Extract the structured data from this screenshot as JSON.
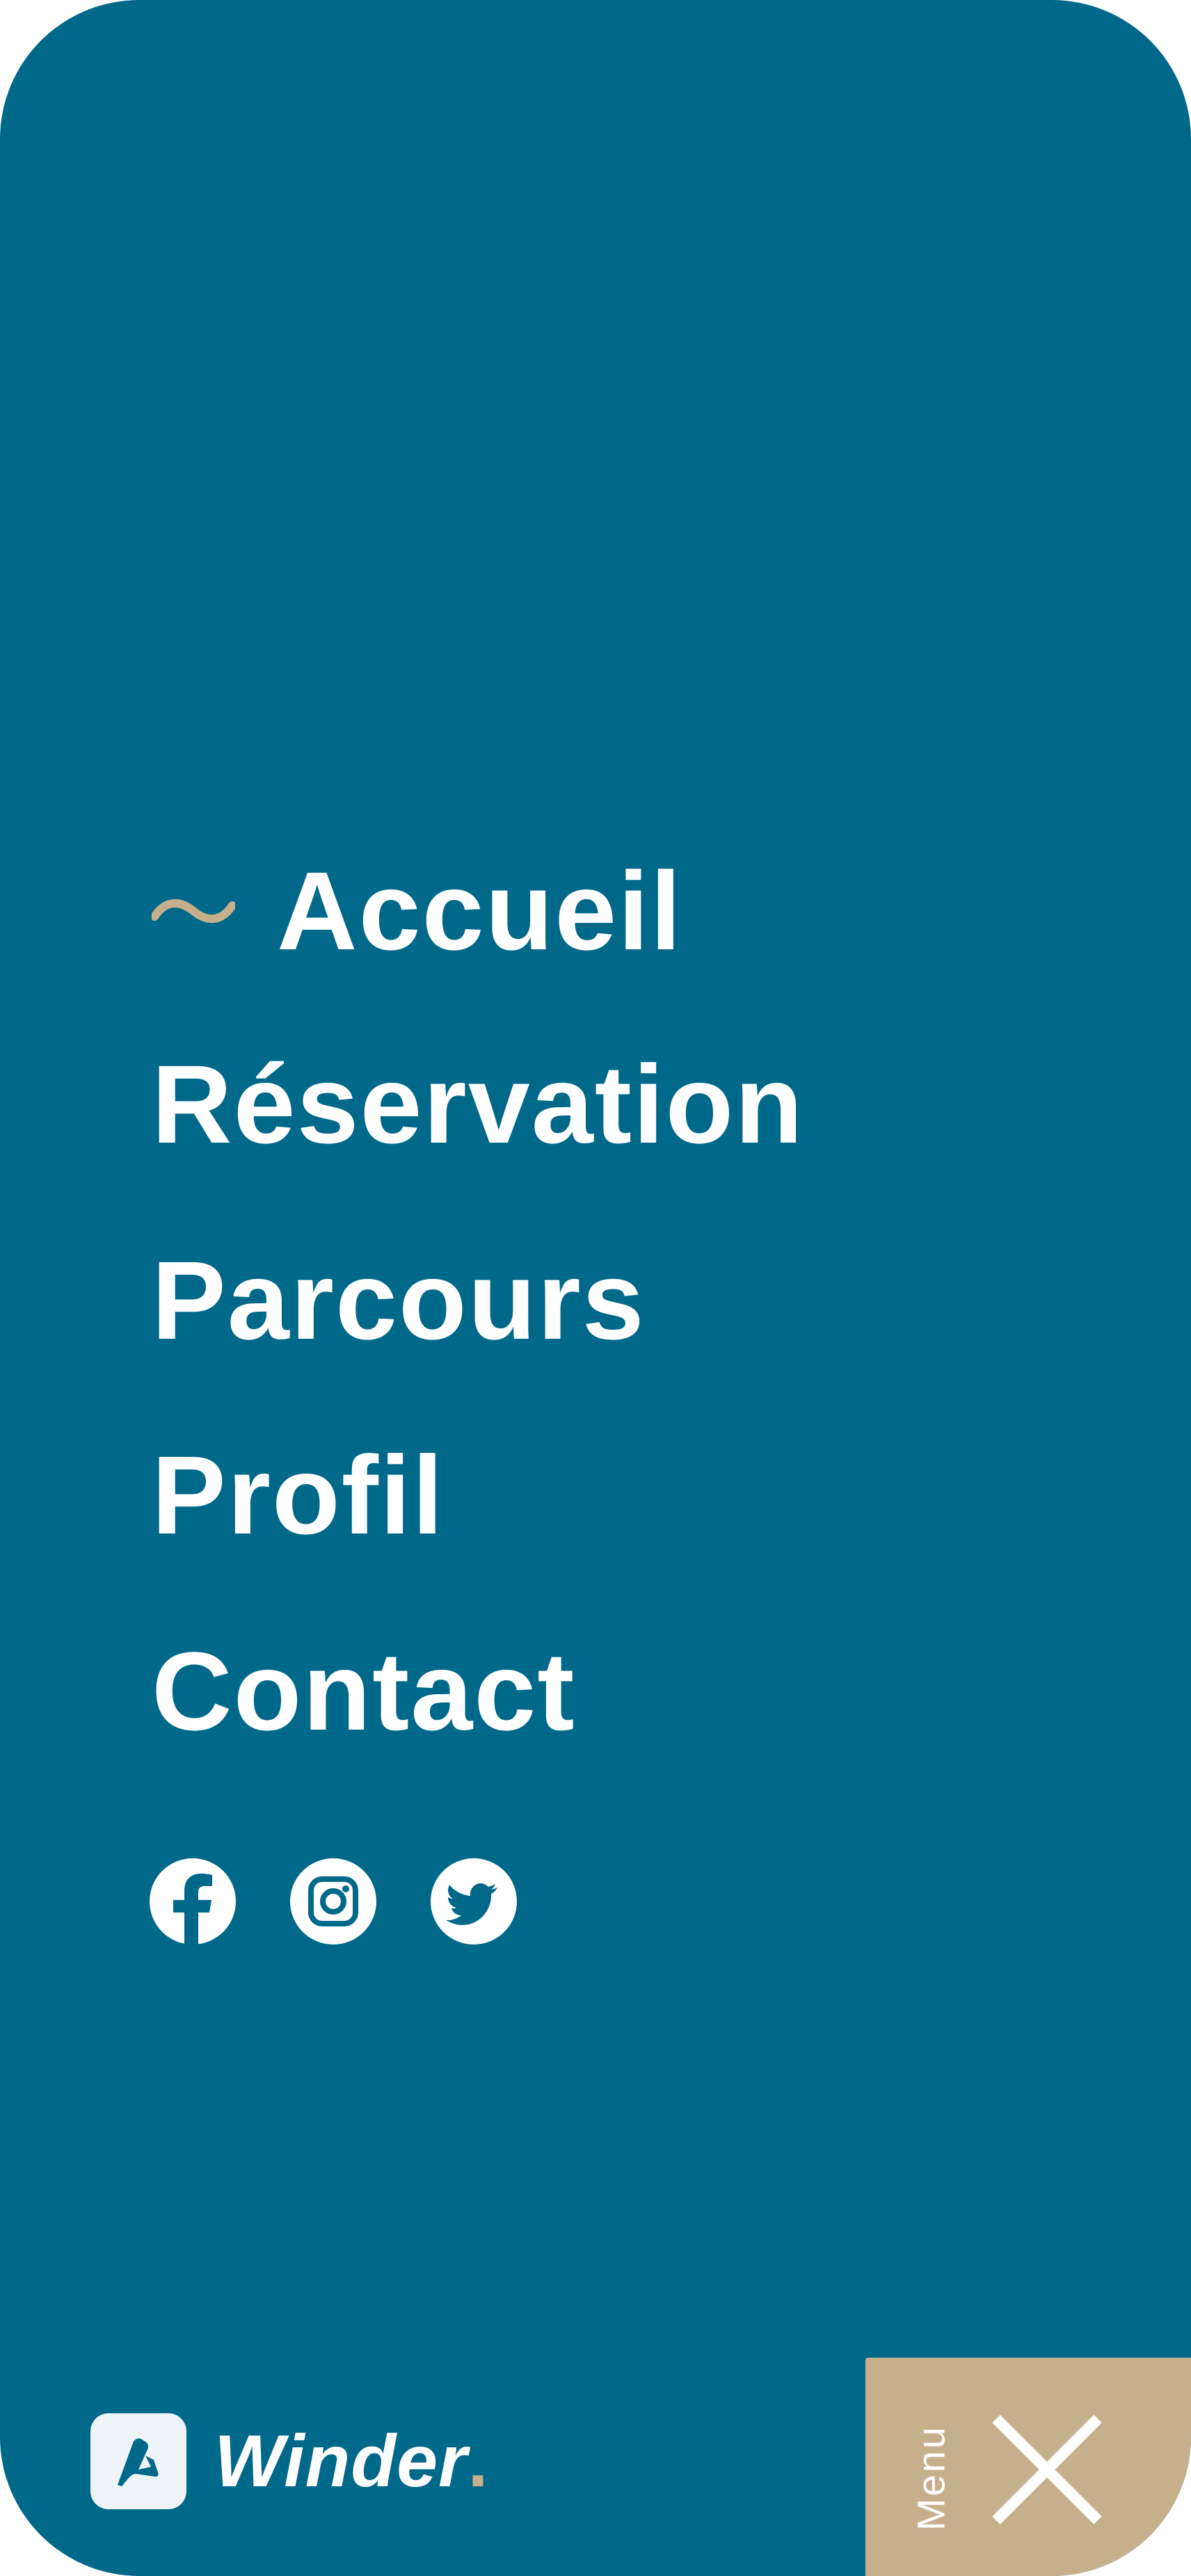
{
  "nav": {
    "items": [
      {
        "label": "Accueil",
        "active": true
      },
      {
        "label": "Réservation"
      },
      {
        "label": "Parcours"
      },
      {
        "label": "Profil"
      },
      {
        "label": "Contact"
      }
    ]
  },
  "socials": [
    "facebook-icon",
    "instagram-icon",
    "twitter-icon"
  ],
  "brand": {
    "name": "Winder",
    "dot": "."
  },
  "menu_button": {
    "label": "Menu",
    "icon": "close-icon"
  },
  "colors": {
    "background": "#006889",
    "accent": "#c6b08b",
    "text": "#ffffff"
  }
}
